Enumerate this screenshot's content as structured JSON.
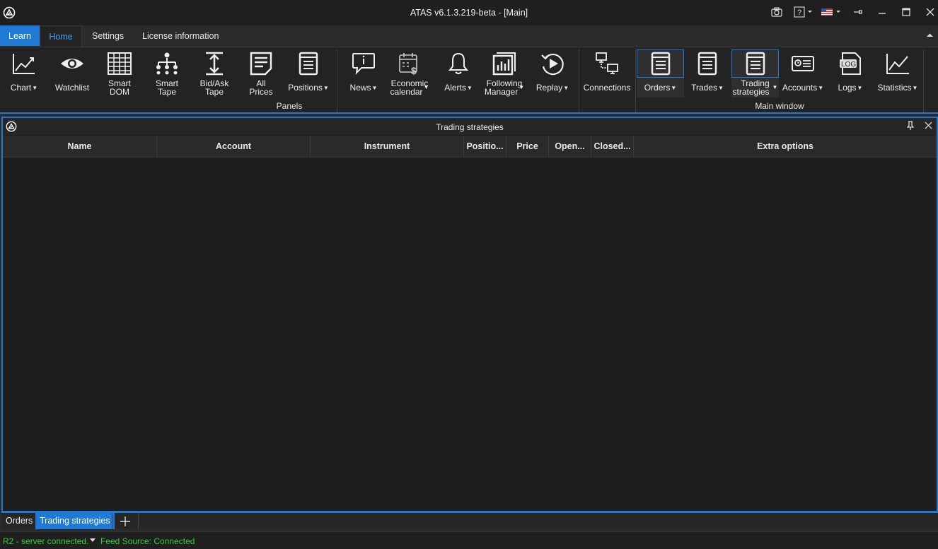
{
  "window": {
    "title": "ATAS v6.1.3.219-beta - [Main]",
    "icons": [
      "atas-logo-icon",
      "camera-icon",
      "help-icon",
      "us-flag-icon",
      "pin-icon",
      "minimize-icon",
      "maximize-icon",
      "close-icon"
    ]
  },
  "ribbon_tabs": {
    "learn": "Learn",
    "home": "Home",
    "settings": "Settings",
    "license": "License information"
  },
  "ribbon": {
    "chart": "Chart",
    "watchlist": "Watchlist",
    "smart_dom_1": "Smart",
    "smart_dom_2": "DOM",
    "smart_tape_1": "Smart",
    "smart_tape_2": "Tape",
    "bidask_1": "Bid/Ask",
    "bidask_2": "Tape",
    "allprices_1": "All",
    "allprices_2": "Prices",
    "positions": "Positions",
    "news": "News",
    "econ_1": "Economic",
    "econ_2": "calendar",
    "alerts": "Alerts",
    "follow_1": "Following",
    "follow_2": "Manager",
    "replay": "Replay",
    "connections": "Connections",
    "orders": "Orders",
    "trades": "Trades",
    "strat_1": "Trading",
    "strat_2": "strategies",
    "accounts": "Accounts",
    "logs": "Logs",
    "log_badge": "LOG",
    "statistics": "Statistics",
    "group_panels": "Panels",
    "group_main": "Main window"
  },
  "panel": {
    "title": "Trading strategies",
    "columns": [
      "Name",
      "Account",
      "Instrument",
      "Positio...",
      "Price",
      "Open...",
      "Closed...",
      "Extra options"
    ]
  },
  "bottom_tabs": {
    "orders": "Orders",
    "strategies": "Trading strategies",
    "add": "+"
  },
  "status": {
    "server": "R2 - server connected.",
    "feed": "Feed Source: Connected"
  },
  "colors": {
    "accent": "#1e7ad6",
    "status_ok": "#33d03a",
    "home_tab_text": "#3ea0ff"
  }
}
